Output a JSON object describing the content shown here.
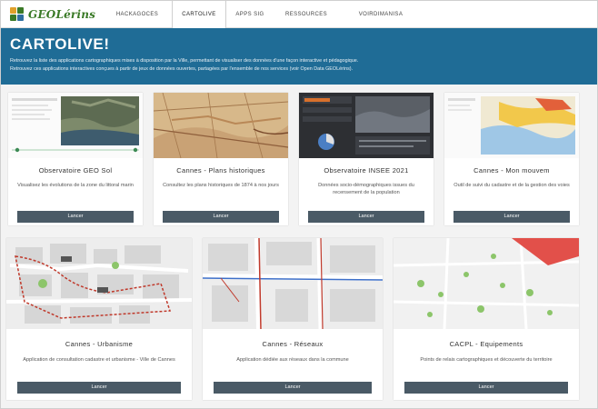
{
  "app": {
    "logo_text": "GEOLérins"
  },
  "nav": {
    "tabs": [
      {
        "label": "HACKAGOCES"
      },
      {
        "label": "CARTOLIVE"
      },
      {
        "label": "APPS SIG"
      },
      {
        "label": "RESSOURCES"
      },
      {
        "label": "VOIRDIMANISA"
      }
    ],
    "active_index": 1
  },
  "header": {
    "title": "CARTOLIVE!",
    "line1": "Retrouvez la liste des applications cartographiques mises à disposition par la Ville, permettant de visualiser des données d'une façon interactive et pédagogique.",
    "line2": "Retrouvez ces applications interactives conçues à partir de jeux de données ouvertes, partagées par l'ensemble de nos services (voir Open Data GEOLérins)."
  },
  "cards": [
    {
      "title": "Observatoire GEO Sol",
      "desc": "Visualisez les évolutions de la zone du littoral marin",
      "button": "Lancer"
    },
    {
      "title": "Cannes - Plans historiques",
      "desc": "Consultez les plans historiques de 1874 à nos jours",
      "button": "Lancer"
    },
    {
      "title": "Observatoire INSEE 2021",
      "desc": "Données socio-démographiques issues du recensement de la population",
      "button": "Lancer"
    },
    {
      "title": "Cannes - Mon mouvem",
      "desc": "Outil de suivi du cadastre et de la gestion des voies",
      "button": "Lancer"
    },
    {
      "title": "Cannes - Urbanisme",
      "desc": "Application de consultation cadastre et urbanisme - Ville de Cannes",
      "button": "Lancer"
    },
    {
      "title": "Cannes - Réseaux",
      "desc": "Application dédiée aux réseaux dans la commune",
      "button": "Lancer"
    },
    {
      "title": "CACPL - Equipements",
      "desc": "Points de relais cartographiques et découverte du territoire",
      "button": "Lancer"
    }
  ],
  "colors": {
    "header_band": "#1f6c96",
    "button": "#4a5a66",
    "logo_green": "#3a7a27"
  }
}
